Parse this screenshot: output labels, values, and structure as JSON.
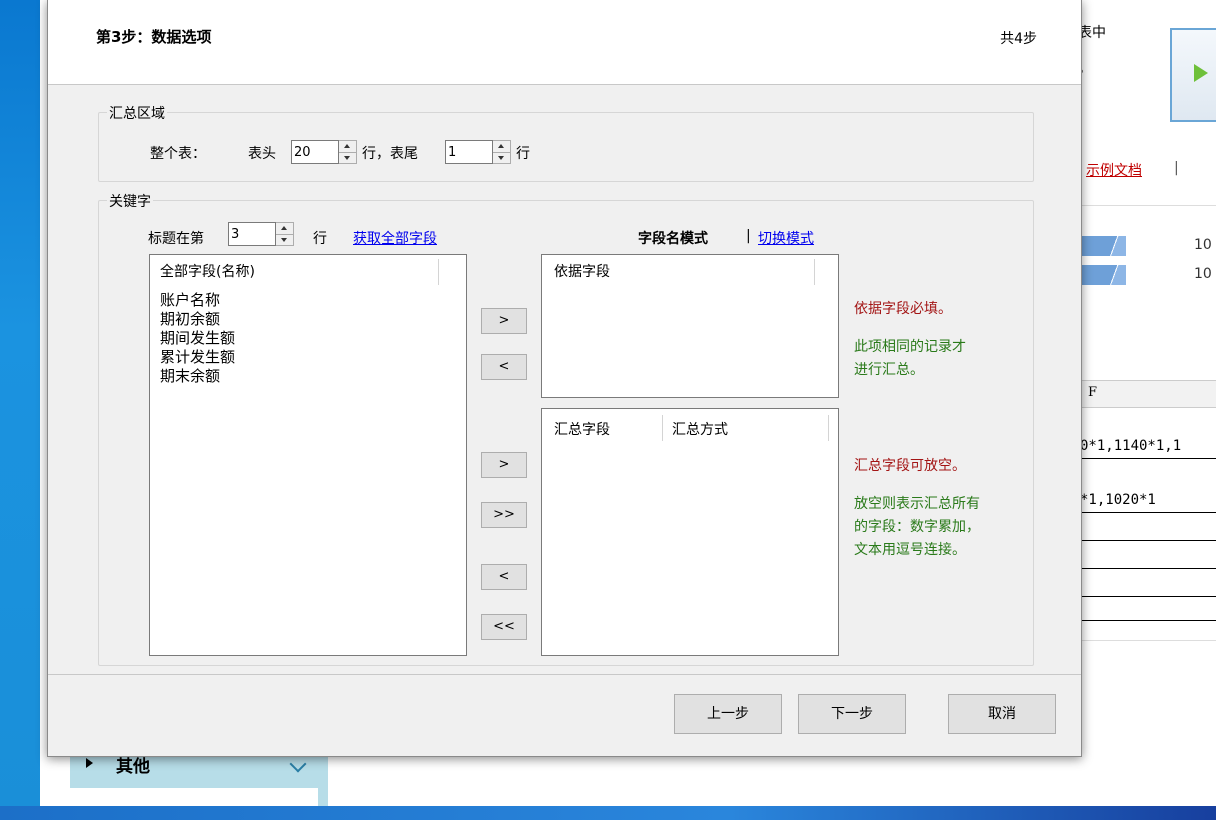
{
  "background": {
    "text_biaozhong": "表中",
    "text_dot": "，",
    "example_doc": "示例文档",
    "pipe": "|",
    "nums": [
      "10",
      "10"
    ],
    "col_header": "F",
    "cells": [
      "0*1,1140*1,1",
      "*1,1020*1"
    ],
    "left_nav_label": "其他"
  },
  "dialog": {
    "step_title": "第3步：数据选项",
    "step_total": "共4步",
    "summary_area": {
      "legend": "汇总区域",
      "whole_table": "整个表：",
      "header_label": "表头",
      "header_value": "20",
      "rows_mid": "行，表尾",
      "footer_value": "1",
      "rows_end": "行"
    },
    "keywords": {
      "legend": "关键字",
      "title_row_label": "标题在第",
      "title_row_value": "3",
      "title_row_unit": "行",
      "get_all_fields": "获取全部字段",
      "mode_label": "字段名模式",
      "mode_sep": "|",
      "switch_mode": "切换模式",
      "all_fields_header": "全部字段(名称)",
      "all_fields": [
        "账户名称",
        "期初余额",
        "期间发生额",
        "累计发生额",
        "期末余额"
      ],
      "basis_header": "依据字段",
      "summary_field_header": "汇总字段",
      "summary_method_header": "汇总方式",
      "btn_add": ">",
      "btn_remove": "<",
      "btn_add_all": ">>",
      "btn_remove_all": "<<",
      "note_basis_required": "依据字段必填。",
      "note_basis_desc": [
        "此项相同的记录才",
        "进行汇总。"
      ],
      "note_summary_optional": "汇总字段可放空。",
      "note_summary_desc": [
        "放空则表示汇总所有",
        "的字段：数字累加，",
        "文本用逗号连接。"
      ]
    },
    "buttons": {
      "prev": "上一步",
      "next": "下一步",
      "cancel": "取消"
    }
  }
}
